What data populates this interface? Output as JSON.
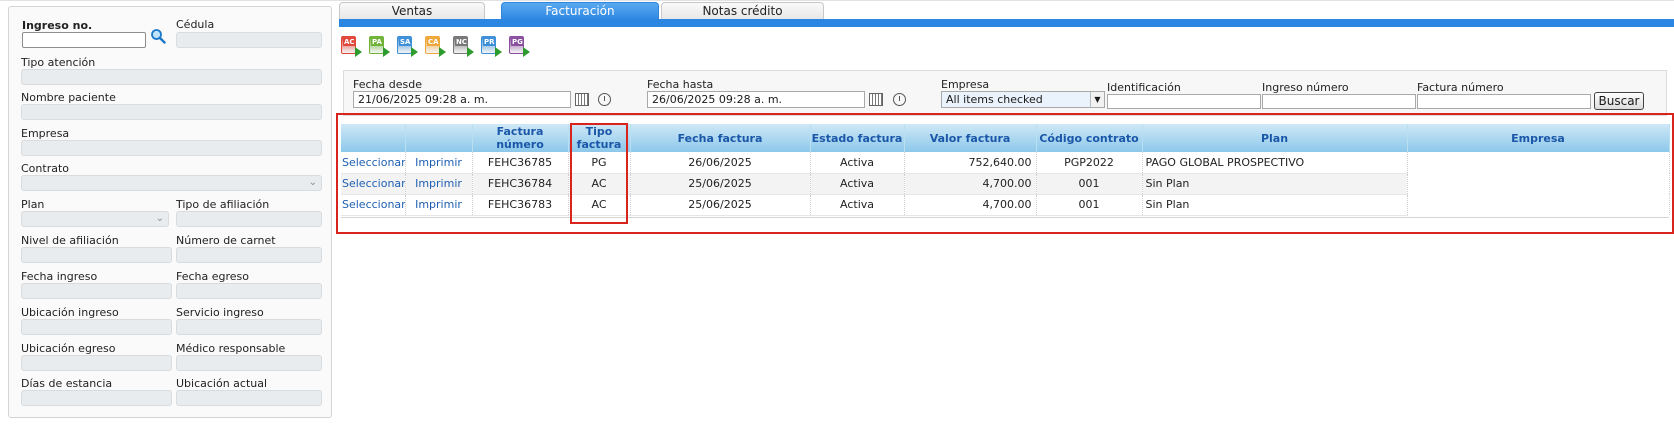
{
  "tabs": [
    {
      "label": "Ventas"
    },
    {
      "label": "Facturación"
    },
    {
      "label": "Notas crédito"
    }
  ],
  "left_panel": {
    "ingreso_no_label": "Ingreso no.",
    "cedula_label": "Cédula",
    "tipo_atencion_label": "Tipo atención",
    "nombre_paciente_label": "Nombre paciente",
    "empresa_label": "Empresa",
    "contrato_label": "Contrato",
    "plan_label": "Plan",
    "tipo_afiliacion_label": "Tipo de afiliación",
    "nivel_afiliacion_label": "Nivel de afiliación",
    "numero_carnet_label": "Número de carnet",
    "fecha_ingreso_label": "Fecha ingreso",
    "fecha_egreso_label": "Fecha egreso",
    "ubicacion_ingreso_label": "Ubicación ingreso",
    "servicio_ingreso_label": "Servicio ingreso",
    "ubicacion_egreso_label": "Ubicación egreso",
    "medico_responsable_label": "Médico responsable",
    "dias_estancia_label": "Días de estancia",
    "ubicacion_actual_label": "Ubicación actual"
  },
  "toolbar": {
    "icons": [
      {
        "name": "ac-report-icon",
        "badge": "AC",
        "color": "#e0463a"
      },
      {
        "name": "pa-report-icon",
        "badge": "PA",
        "color": "#6fb339"
      },
      {
        "name": "sa-report-icon",
        "badge": "SA",
        "color": "#3d8fd8"
      },
      {
        "name": "ca-report-icon",
        "badge": "CA",
        "color": "#f0a73a"
      },
      {
        "name": "nc-report-icon",
        "badge": "NC",
        "color": "#777777"
      },
      {
        "name": "pr-report-icon",
        "badge": "PR",
        "color": "#3d8fd8"
      },
      {
        "name": "pg-report-icon",
        "badge": "PG",
        "color": "#8a4f9e"
      }
    ]
  },
  "filters": {
    "fecha_desde_label": "Fecha desde",
    "fecha_desde_value": "21/06/2025 09:28 a. m.",
    "fecha_hasta_label": "Fecha hasta",
    "fecha_hasta_value": "26/06/2025 09:28 a. m.",
    "empresa_label": "Empresa",
    "empresa_value": "All items checked",
    "identificacion_label": "Identificación",
    "ingreso_numero_label": "Ingreso número",
    "factura_numero_label": "Factura número",
    "buscar_label": "Buscar"
  },
  "grid": {
    "columns": [
      "",
      "",
      "Factura número",
      "Tipo factura",
      "Fecha factura",
      "Estado factura",
      "Valor factura",
      "Código contrato",
      "Plan",
      "Empresa"
    ],
    "rows": [
      {
        "select": "Seleccionar",
        "print": "Imprimir",
        "factura": "FEHC36785",
        "tipo": "PG",
        "fecha": "26/06/2025",
        "estado": "Activa",
        "valor": "752,640.00",
        "contrato": "PGP2022",
        "plan": "PAGO GLOBAL PROSPECTIVO",
        "empresa": ""
      },
      {
        "select": "Seleccionar",
        "print": "Imprimir",
        "factura": "FEHC36784",
        "tipo": "AC",
        "fecha": "25/06/2025",
        "estado": "Activa",
        "valor": "4,700.00",
        "contrato": "001",
        "plan": "Sin Plan",
        "empresa": ""
      },
      {
        "select": "Seleccionar",
        "print": "Imprimir",
        "factura": "FEHC36783",
        "tipo": "AC",
        "fecha": "25/06/2025",
        "estado": "Activa",
        "valor": "4,700.00",
        "contrato": "001",
        "plan": "Sin Plan",
        "empresa": ""
      }
    ]
  },
  "colors": {
    "accent": "#2a86e0",
    "highlight": "#d9241d",
    "header_text": "#1b57a8"
  }
}
